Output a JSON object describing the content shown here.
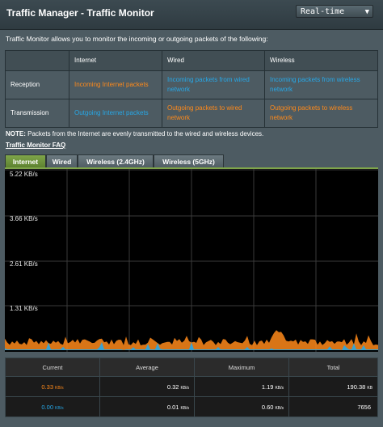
{
  "header": {
    "title": "Traffic Manager - Traffic Monitor",
    "mode_select": "Real-time"
  },
  "description": "Traffic Monitor allows you to monitor the incoming or outgoing packets of the following:",
  "matrix": {
    "columns": [
      "Internet",
      "Wired",
      "Wireless"
    ],
    "rows": [
      {
        "label": "Reception",
        "internet": "Incoming Internet packets",
        "wired": "Incoming packets from wired network",
        "wireless": "Incoming packets from wireless network"
      },
      {
        "label": "Transmission",
        "internet": "Outgoing Internet packets",
        "wired": "Outgoing packets to wired network",
        "wireless": "Outgoing packets to wireless network"
      }
    ]
  },
  "note": {
    "label": "NOTE:",
    "text": " Packets from the Internet are evenly transmitted to the wired and wireless devices."
  },
  "faq_link": "Traffic Monitor FAQ",
  "tabs": [
    "Internet",
    "Wired",
    "Wireless (2.4GHz)",
    "Wireless (5GHz)"
  ],
  "active_tab": 0,
  "chart": {
    "y_labels": [
      "5.22 KB/s",
      "3.66 KB/s",
      "2.61 KB/s",
      "1.31 KB/s"
    ],
    "colors": {
      "reception": "#ff8a1a",
      "transmission": "#27a7e6",
      "background": "#000000",
      "grid": "#3a3a3a"
    }
  },
  "stats": {
    "headers": [
      "Current",
      "Average",
      "Maximum",
      "Total"
    ],
    "rows": [
      {
        "current": "0.33",
        "avg": "0.32",
        "max": "1.19",
        "total": "190.38",
        "unit": "KB/s",
        "total_unit": "KB",
        "color": "#ff8a1a"
      },
      {
        "current": "0.00",
        "avg": "0.01",
        "max": "0.60",
        "total": "7656",
        "unit": "KB/s",
        "total_unit": "",
        "color": "#27a7e6"
      }
    ]
  }
}
